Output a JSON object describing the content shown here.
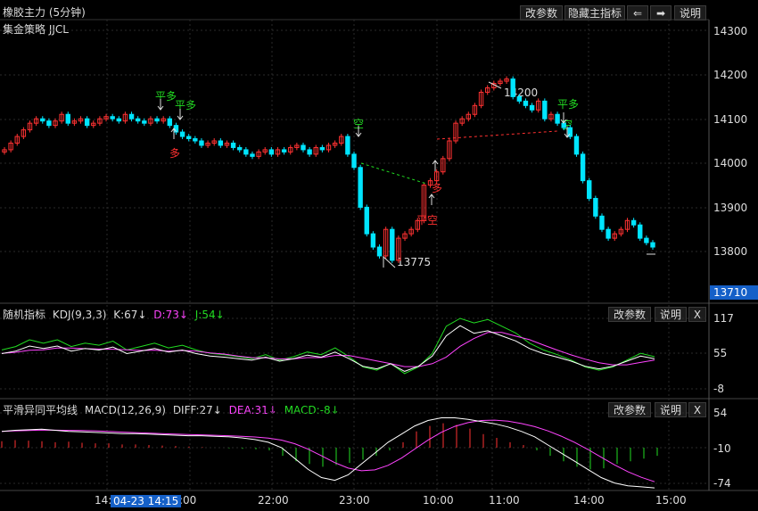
{
  "main": {
    "title": "橡胶主力 (5分钟)",
    "strategy": "集金策略 JJCL",
    "buttons": {
      "params": "改参数",
      "hide": "隐藏主指标",
      "left": "⇐",
      "right": "➡",
      "help": "说明"
    },
    "yticks": [
      "14300",
      "14200",
      "14100",
      "14000",
      "13900",
      "13800"
    ],
    "current_price": "13710",
    "high_label": "14200",
    "low_label": "13775",
    "signals": [
      "平多",
      "平多",
      "多",
      "空",
      "多",
      "平空",
      "平多",
      "空"
    ]
  },
  "kdj": {
    "name": "随机指标",
    "params": "KDJ(9,3,3)",
    "k": "K:67↓",
    "d": "D:73↓",
    "j": "J:54↓",
    "buttons": {
      "params": "改参数",
      "help": "说明",
      "close": "X"
    },
    "yticks": [
      "117",
      "55",
      "-8"
    ]
  },
  "macd": {
    "name": "平滑异同平均线",
    "params": "MACD(12,26,9)",
    "diff": "DIFF:27↓",
    "dea": "DEA:31↓",
    "macd": "MACD:-8↓",
    "buttons": {
      "params": "改参数",
      "help": "说明",
      "close": "X"
    },
    "yticks": [
      "54",
      "-10",
      "-74"
    ]
  },
  "time_axis": {
    "ticks": [
      "14:",
      ":00",
      "22:00",
      "23:00",
      "10:00",
      "11:00",
      "14:00",
      "15:00"
    ],
    "cursor_label": "04-23 14:15"
  },
  "colors": {
    "up": "#ff3232",
    "down": "#00e5ff",
    "signal_green": "#22dd22",
    "signal_red": "#ff3030",
    "dea": "#ff44ff",
    "accent": "#1560c8"
  }
}
